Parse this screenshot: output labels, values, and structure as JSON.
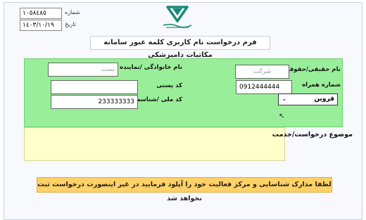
{
  "meta": {
    "number_value": "١٠٥٨٤٨٥",
    "number_label": "شماره",
    "date_value": "١٤٠٣/١٠/١٩",
    "date_label": "تاریخ"
  },
  "title": "فرم درخواست نام کاربری کلمه عبور سامانه مکاتبات دامپزشکی",
  "fields": {
    "legal_name_label": "نام حقیقی/حقوقی",
    "legal_name_value": "شرکت",
    "family_name_label": "نام خانوادگی /نماینده شرکت",
    "family_name_value": "تست",
    "mobile_label": "شماره همراه",
    "mobile_value": "0912444444",
    "postal_label": "کد پستی",
    "postal_value": "",
    "national_label": "کد ملی /شناسه ملی",
    "national_value": "233333333",
    "city_value": "قزوین"
  },
  "request_label": "موضوع درخواست/خدمت",
  "request_value": "",
  "notice": "لطفا مدارک شناسایی و مرکز فعالیت خود را آپلود فرمایید در غیر اینصورت درخواست ثبت نخواهد شد",
  "colors": {
    "green_panel": "#99ef99",
    "yellow_panel": "#ffffcc",
    "notice_bg": "#ffd166",
    "logo_teal": "#1a8a7a"
  },
  "icons": {
    "logo": "veterinary-logo-icon",
    "dropdown": "chevron-down-icon",
    "cursor": "mouse-cursor-icon"
  }
}
